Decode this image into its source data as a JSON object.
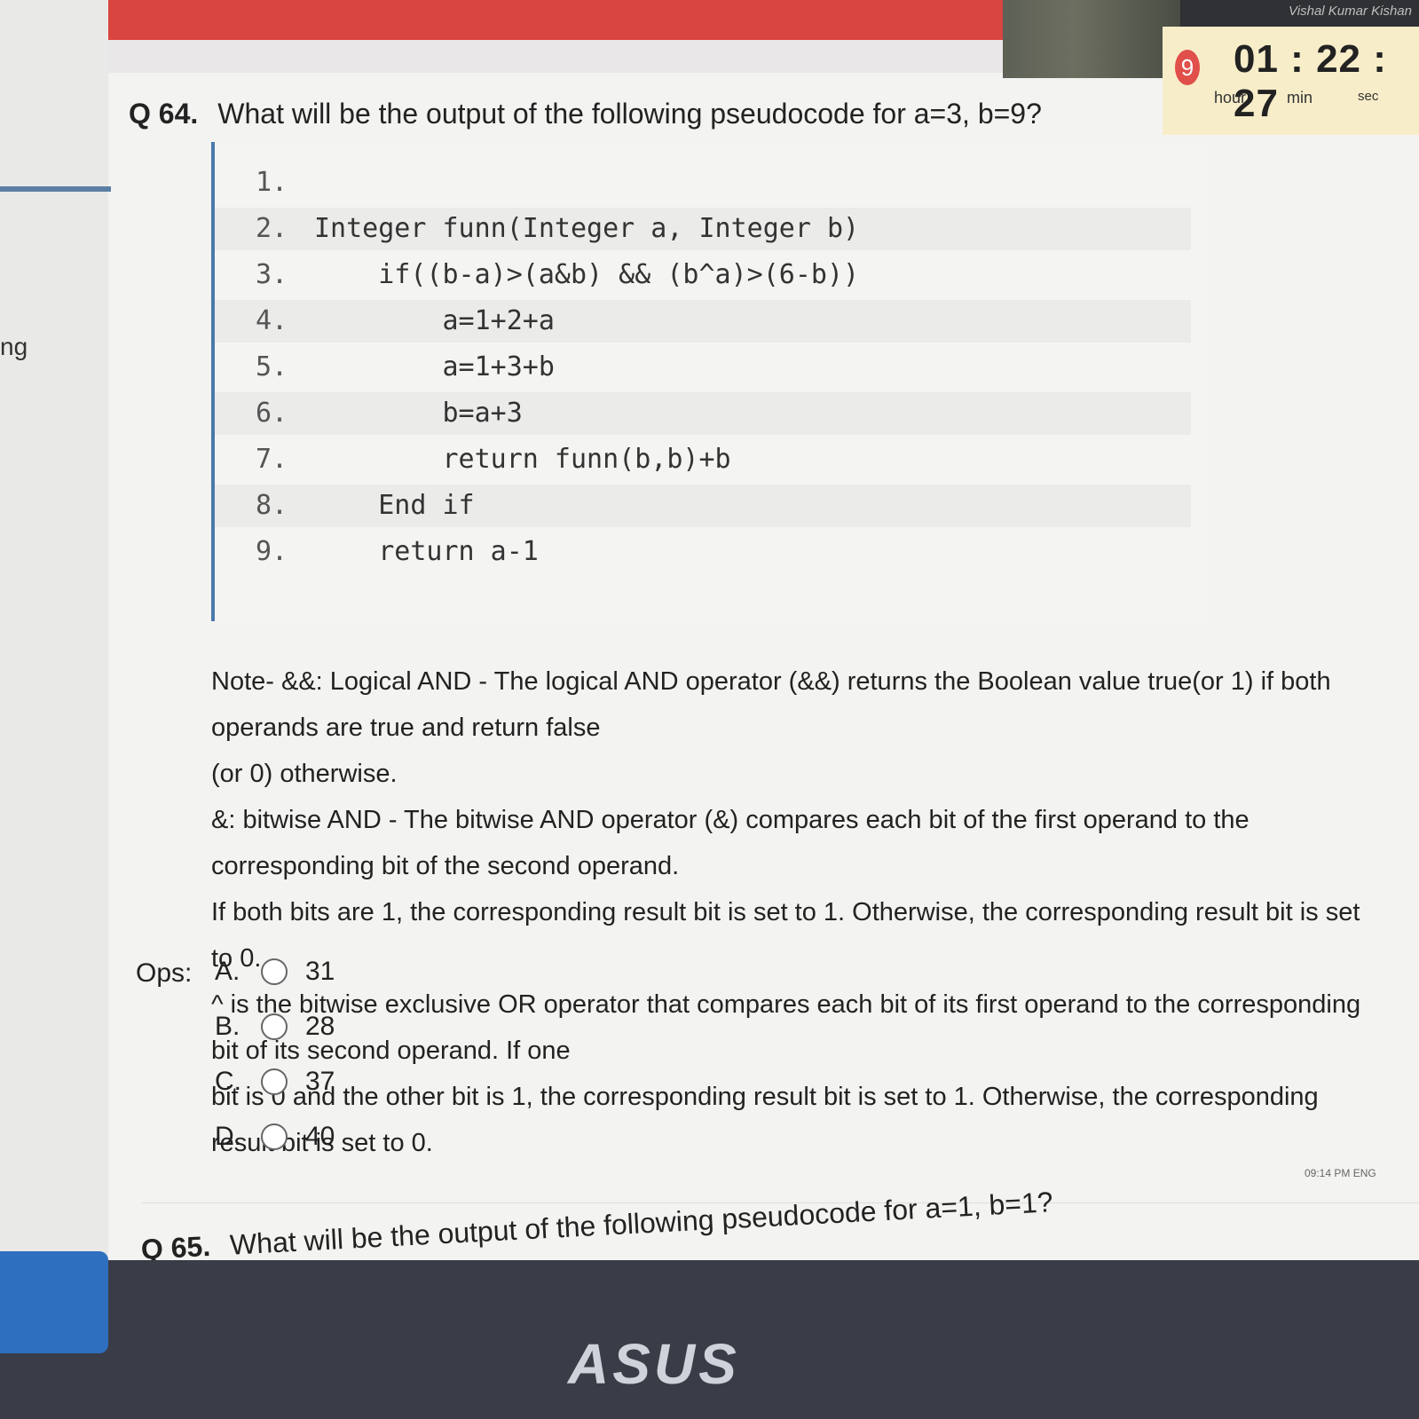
{
  "timer": {
    "question_number": "9",
    "hours": "01",
    "minutes": "22",
    "seconds": "27",
    "hour_label": "hour",
    "min_label": "min",
    "sec_label": "sec",
    "user_name": "Vishal Kumar Kishan"
  },
  "left_panel": {
    "fragment": "ng"
  },
  "question": {
    "number": "Q 64.",
    "text": "What will be the output of the following pseudocode for a=3, b=9?",
    "code_lines": [
      {
        "no": "1.",
        "code": ""
      },
      {
        "no": "2.",
        "code": "Integer funn(Integer a, Integer b)"
      },
      {
        "no": "3.",
        "code": "    if((b-a)>(a&b) && (b^a)>(6-b))"
      },
      {
        "no": "4.",
        "code": "        a=1+2+a"
      },
      {
        "no": "5.",
        "code": "        a=1+3+b"
      },
      {
        "no": "6.",
        "code": "        b=a+3"
      },
      {
        "no": "7.",
        "code": "        return funn(b,b)+b"
      },
      {
        "no": "8.",
        "code": "    End if"
      },
      {
        "no": "9.",
        "code": "    return a-1"
      }
    ],
    "note_lines": [
      "Note- &&: Logical AND - The logical AND operator (&&) returns the Boolean value true(or 1) if both operands are true and return false",
      "(or 0) otherwise.",
      "&: bitwise AND - The bitwise AND operator (&) compares each bit of the first operand to the corresponding bit of the second operand.",
      "If both bits are 1, the corresponding result bit is set to 1. Otherwise, the corresponding result bit is set to 0.",
      "^ is the bitwise exclusive OR operator that compares each bit of its first operand to the corresponding bit of its second operand. If one",
      "bit is 0 and the other bit is 1, the corresponding result bit is set to 1. Otherwise, the corresponding result bit is set to 0."
    ],
    "ops_label": "Ops:",
    "options": [
      {
        "letter": "A.",
        "value": "31"
      },
      {
        "letter": "B.",
        "value": "28"
      },
      {
        "letter": "C.",
        "value": "37"
      },
      {
        "letter": "D.",
        "value": "40"
      }
    ]
  },
  "next_question": {
    "number": "Q 65.",
    "text": "What will be the output of the following pseudocode for a=1, b=1?"
  },
  "taskbar": {
    "clock": "09:14 PM  ENG"
  },
  "bezel": {
    "brand": "ASUS"
  }
}
